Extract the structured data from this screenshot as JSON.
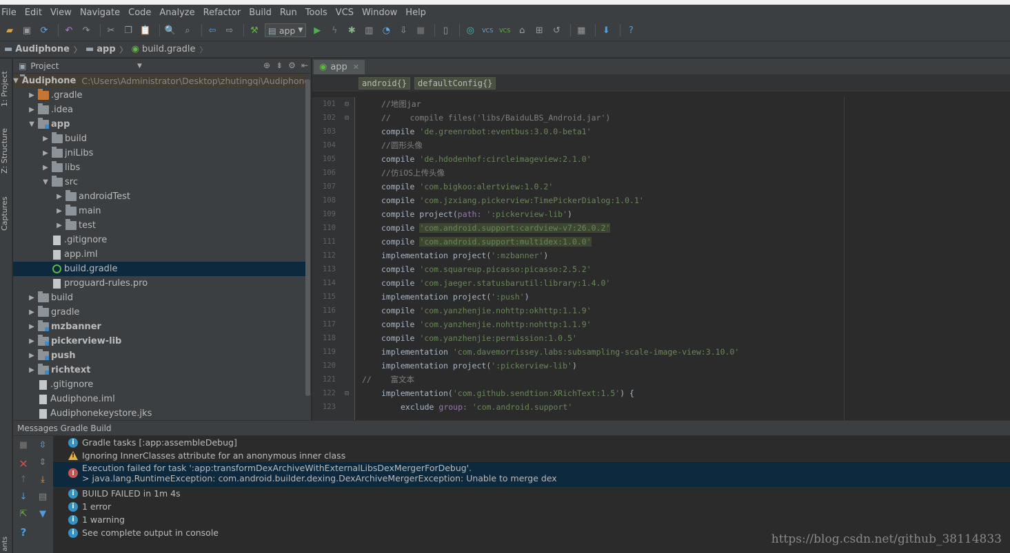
{
  "menu": [
    "File",
    "Edit",
    "View",
    "Navigate",
    "Code",
    "Analyze",
    "Refactor",
    "Build",
    "Run",
    "Tools",
    "VCS",
    "Window",
    "Help"
  ],
  "toolbar": {
    "run_config": "app",
    "vcs1": "VCS",
    "vcs2": "VCS"
  },
  "breadcrumb": [
    "Audiphone",
    "app",
    "build.gradle"
  ],
  "side_tabs": {
    "project": "1: Project",
    "structure": "Z: Structure",
    "captures": "Captures"
  },
  "project_panel": {
    "title": "Project",
    "root_name": "Audiphone",
    "root_path": "C:\\Users\\Administrator\\Desktop\\zhutingqi\\Audiphone",
    "items": [
      {
        "label": ".gradle",
        "depth": 1,
        "arrow": "▶",
        "icon": "folder-orange"
      },
      {
        "label": ".idea",
        "depth": 1,
        "arrow": "▶",
        "icon": "folder"
      },
      {
        "label": "app",
        "depth": 1,
        "arrow": "▼",
        "icon": "folder-module",
        "bold": true
      },
      {
        "label": "build",
        "depth": 2,
        "arrow": "▶",
        "icon": "folder"
      },
      {
        "label": "jniLibs",
        "depth": 2,
        "arrow": "▶",
        "icon": "folder"
      },
      {
        "label": "libs",
        "depth": 2,
        "arrow": "▶",
        "icon": "folder"
      },
      {
        "label": "src",
        "depth": 2,
        "arrow": "▼",
        "icon": "folder"
      },
      {
        "label": "androidTest",
        "depth": 3,
        "arrow": "▶",
        "icon": "folder"
      },
      {
        "label": "main",
        "depth": 3,
        "arrow": "▶",
        "icon": "folder"
      },
      {
        "label": "test",
        "depth": 3,
        "arrow": "▶",
        "icon": "folder"
      },
      {
        "label": ".gitignore",
        "depth": 2,
        "arrow": "",
        "icon": "file"
      },
      {
        "label": "app.iml",
        "depth": 2,
        "arrow": "",
        "icon": "file"
      },
      {
        "label": "build.gradle",
        "depth": 2,
        "arrow": "",
        "icon": "gradle",
        "selected": true
      },
      {
        "label": "proguard-rules.pro",
        "depth": 2,
        "arrow": "",
        "icon": "file"
      },
      {
        "label": "build",
        "depth": 1,
        "arrow": "▶",
        "icon": "folder"
      },
      {
        "label": "gradle",
        "depth": 1,
        "arrow": "▶",
        "icon": "folder"
      },
      {
        "label": "mzbanner",
        "depth": 1,
        "arrow": "▶",
        "icon": "folder-module",
        "bold": true
      },
      {
        "label": "pickerview-lib",
        "depth": 1,
        "arrow": "▶",
        "icon": "folder-module",
        "bold": true
      },
      {
        "label": "push",
        "depth": 1,
        "arrow": "▶",
        "icon": "folder-module",
        "bold": true
      },
      {
        "label": "richtext",
        "depth": 1,
        "arrow": "▶",
        "icon": "folder-module",
        "bold": true
      },
      {
        "label": ".gitignore",
        "depth": 1,
        "arrow": "",
        "icon": "file"
      },
      {
        "label": "Audiphone.iml",
        "depth": 1,
        "arrow": "",
        "icon": "file"
      },
      {
        "label": "Audiphonekeystore.jks",
        "depth": 1,
        "arrow": "",
        "icon": "file"
      }
    ]
  },
  "editor": {
    "tab": "app",
    "breadcrumbs": [
      "android{}",
      "defaultConfig{}"
    ],
    "lines": [
      {
        "n": "101",
        "fold": "⊟",
        "html": [
          {
            "c": "cm",
            "t": "//地图jar"
          }
        ]
      },
      {
        "n": "102",
        "fold": "⊟",
        "html": [
          {
            "c": "cm",
            "t": "//    compile files('libs/BaiduLBS_Android.jar')"
          }
        ]
      },
      {
        "n": "103",
        "fold": "",
        "html": [
          {
            "c": "kw",
            "t": "compile "
          },
          {
            "c": "st",
            "t": "'de.greenrobot:eventbus:3.0.0-beta1'"
          }
        ]
      },
      {
        "n": "104",
        "fold": "",
        "html": [
          {
            "c": "cm",
            "t": "//圆形头像"
          }
        ]
      },
      {
        "n": "105",
        "fold": "",
        "html": [
          {
            "c": "kw",
            "t": "compile "
          },
          {
            "c": "st",
            "t": "'de.hdodenhof:circleimageview:2.1.0'"
          }
        ]
      },
      {
        "n": "106",
        "fold": "",
        "html": [
          {
            "c": "cm",
            "t": "//仿iOS上传头像"
          }
        ]
      },
      {
        "n": "107",
        "fold": "",
        "html": [
          {
            "c": "kw",
            "t": "compile "
          },
          {
            "c": "st",
            "t": "'com.bigkoo:alertview:1.0.2'"
          }
        ]
      },
      {
        "n": "108",
        "fold": "",
        "html": [
          {
            "c": "kw",
            "t": "compile "
          },
          {
            "c": "st",
            "t": "'com.jzxiang.pickerview:TimePickerDialog:1.0.1'"
          }
        ]
      },
      {
        "n": "109",
        "fold": "",
        "html": [
          {
            "c": "kw",
            "t": "compile project("
          },
          {
            "c": "pn",
            "t": "path: "
          },
          {
            "c": "st",
            "t": "':pickerview-lib'"
          },
          {
            "c": "kw",
            "t": ")"
          }
        ]
      },
      {
        "n": "110",
        "fold": "",
        "html": [
          {
            "c": "kw",
            "t": "compile "
          },
          {
            "c": "st hl-str",
            "t": "'com.android.support:cardview-v7:26.0.2'"
          }
        ]
      },
      {
        "n": "111",
        "fold": "",
        "html": [
          {
            "c": "kw",
            "t": "compile "
          },
          {
            "c": "st hl-str",
            "t": "'com.android.support:multidex:1.0.0'"
          }
        ]
      },
      {
        "n": "112",
        "fold": "",
        "html": [
          {
            "c": "kw",
            "t": "implementation project("
          },
          {
            "c": "st",
            "t": "':mzbanner'"
          },
          {
            "c": "kw",
            "t": ")"
          }
        ]
      },
      {
        "n": "113",
        "fold": "",
        "html": [
          {
            "c": "kw",
            "t": "compile "
          },
          {
            "c": "st",
            "t": "'com.squareup.picasso:picasso:2.5.2'"
          }
        ]
      },
      {
        "n": "114",
        "fold": "",
        "html": [
          {
            "c": "kw",
            "t": "compile "
          },
          {
            "c": "st",
            "t": "'com.jaeger.statusbarutil:library:1.4.0'"
          }
        ]
      },
      {
        "n": "115",
        "fold": "",
        "html": [
          {
            "c": "kw",
            "t": "implementation project("
          },
          {
            "c": "st",
            "t": "':push'"
          },
          {
            "c": "kw",
            "t": ")"
          }
        ]
      },
      {
        "n": "116",
        "fold": "",
        "html": [
          {
            "c": "kw",
            "t": "compile "
          },
          {
            "c": "st",
            "t": "'com.yanzhenjie.nohttp:okhttp:1.1.9'"
          }
        ]
      },
      {
        "n": "117",
        "fold": "",
        "html": [
          {
            "c": "kw",
            "t": "compile "
          },
          {
            "c": "st",
            "t": "'com.yanzhenjie.nohttp:nohttp:1.1.9'"
          }
        ]
      },
      {
        "n": "118",
        "fold": "",
        "html": [
          {
            "c": "kw",
            "t": "compile "
          },
          {
            "c": "st",
            "t": "'com.yanzhenjie:permission:1.0.5'"
          }
        ]
      },
      {
        "n": "119",
        "fold": "",
        "html": [
          {
            "c": "kw",
            "t": "implementation "
          },
          {
            "c": "st",
            "t": "'com.davemorrissey.labs:subsampling-scale-image-view:3.10.0'"
          }
        ]
      },
      {
        "n": "120",
        "fold": "",
        "html": [
          {
            "c": "kw",
            "t": "implementation project("
          },
          {
            "c": "st",
            "t": "':pickerview-lib'"
          },
          {
            "c": "kw",
            "t": ")"
          }
        ]
      },
      {
        "n": "121",
        "fold": "",
        "outdent": true,
        "html": [
          {
            "c": "cm",
            "t": "//    富文本"
          }
        ]
      },
      {
        "n": "122",
        "fold": "⊟",
        "html": [
          {
            "c": "kw",
            "t": "implementation("
          },
          {
            "c": "st",
            "t": "'com.github.sendtion:XRichText:1.5'"
          },
          {
            "c": "kw",
            "t": ") {"
          }
        ]
      },
      {
        "n": "123",
        "fold": "",
        "indent2": true,
        "html": [
          {
            "c": "kw",
            "t": "exclude "
          },
          {
            "c": "pn",
            "t": "group: "
          },
          {
            "c": "st",
            "t": "'com.android.support'"
          }
        ]
      }
    ]
  },
  "messages": {
    "header": "Messages Gradle Build",
    "rows": [
      {
        "type": "info",
        "text": "Gradle tasks [:app:assembleDebug]"
      },
      {
        "type": "warn",
        "text": "Ignoring InnerClasses attribute for an anonymous inner class"
      },
      {
        "type": "err",
        "text": "Execution failed for task ':app:transformDexArchiveWithExternalLibsDexMergerForDebug'.",
        "text2": "> java.lang.RuntimeException: com.android.builder.dexing.DexArchiveMergerException: Unable to merge dex"
      },
      {
        "type": "info",
        "text": "BUILD FAILED in 1m 4s"
      },
      {
        "type": "info",
        "text": "1 error"
      },
      {
        "type": "info",
        "text": "1 warning"
      },
      {
        "type": "info",
        "text": "See complete output in console"
      }
    ]
  },
  "bottom_tab": "ants",
  "watermark": "https://blog.csdn.net/github_38114833"
}
